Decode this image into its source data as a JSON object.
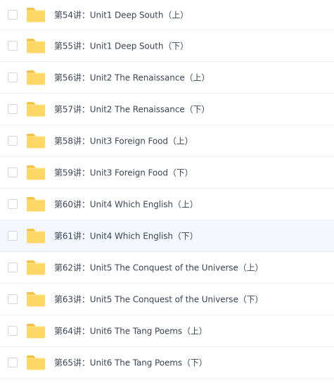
{
  "colors": {
    "folder_body": "#ffd766",
    "folder_tab": "#f6c143",
    "text": "#3b4554",
    "row_highlight": "#f4f8fe",
    "divider": "#f0f2f5"
  },
  "file_list": {
    "items": [
      {
        "name": "第54讲：Unit1 Deep South（上）",
        "icon": "folder-icon"
      },
      {
        "name": "第55讲：Unit1 Deep South（下）",
        "icon": "folder-icon"
      },
      {
        "name": "第56讲：Unit2 The Renaissance（上）",
        "icon": "folder-icon"
      },
      {
        "name": "第57讲：Unit2 The Renaissance（下）",
        "icon": "folder-icon"
      },
      {
        "name": "第58讲：Unit3 Foreign Food（上）",
        "icon": "folder-icon"
      },
      {
        "name": "第59讲：Unit3 Foreign Food（下）",
        "icon": "folder-icon"
      },
      {
        "name": "第60讲：Unit4 Which English（上）",
        "icon": "folder-icon"
      },
      {
        "name": "第61讲：Unit4 Which English（下）",
        "icon": "folder-icon",
        "highlighted": true
      },
      {
        "name": "第62讲：Unit5 The Conquest of the Universe（上）",
        "icon": "folder-icon"
      },
      {
        "name": "第63讲：Unit5 The Conquest of the Universe（下）",
        "icon": "folder-icon"
      },
      {
        "name": "第64讲：Unit6 The Tang Poems（上）",
        "icon": "folder-icon"
      },
      {
        "name": "第65讲：Unit6 The Tang Poems（下）",
        "icon": "folder-icon"
      }
    ]
  }
}
